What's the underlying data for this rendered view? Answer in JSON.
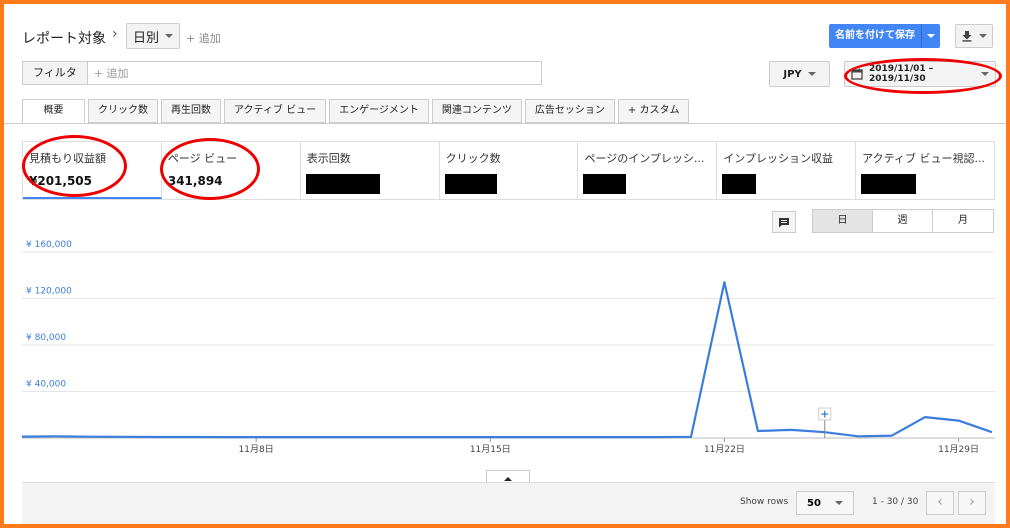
{
  "breadcrumb": {
    "report_target": "レポート対象",
    "separator": "›",
    "grouping": "日別",
    "add_label": "+ 追加"
  },
  "toolbar": {
    "save_label": "名前を付けて保存",
    "currency": "JPY",
    "date_range": "2019/11/01 – 2019/11/30"
  },
  "filter": {
    "label": "フィルタ",
    "placeholder": "+ 追加"
  },
  "tabs": [
    {
      "label": "概要"
    },
    {
      "label": "クリック数"
    },
    {
      "label": "再生回数"
    },
    {
      "label": "アクティブ ビュー"
    },
    {
      "label": "エンゲージメント"
    },
    {
      "label": "関連コンテンツ"
    },
    {
      "label": "広告セッション"
    },
    {
      "label": "+ カスタム"
    }
  ],
  "metrics": [
    {
      "title": "見積もり収益額",
      "value": "¥201,505",
      "redacted_chars": 0
    },
    {
      "title": "ページ ビュー",
      "value": "341,894",
      "redacted_chars": 0
    },
    {
      "title": "表示回数",
      "value": "",
      "redacted_chars": 7
    },
    {
      "title": "クリック数",
      "value": "",
      "redacted_chars": 5
    },
    {
      "title": "ページのインプレッシ...",
      "value": "",
      "redacted_chars": 4
    },
    {
      "title": "インプレッション収益",
      "value": "",
      "redacted_chars": 3
    },
    {
      "title": "アクティブ ビュー視認...",
      "value": "",
      "redacted_chars": 5
    }
  ],
  "granularity": {
    "day": "日",
    "week": "週",
    "month": "月",
    "selected": "day"
  },
  "chart_data": {
    "type": "line",
    "ylim": [
      0,
      160000
    ],
    "yticks": [
      40000,
      80000,
      120000,
      160000
    ],
    "ytick_labels": [
      "¥ 40,000",
      "¥ 80,000",
      "¥ 120,000",
      "¥ 160,000"
    ],
    "x": [
      1,
      2,
      3,
      4,
      5,
      6,
      7,
      8,
      9,
      10,
      11,
      12,
      13,
      14,
      15,
      16,
      17,
      18,
      19,
      20,
      21,
      22,
      23,
      24,
      25,
      26,
      27,
      28,
      29,
      30
    ],
    "xtick_days": [
      8,
      15,
      22,
      29
    ],
    "xtick_labels": [
      "11月8日",
      "11月15日",
      "11月22日",
      "11月29日"
    ],
    "series": [
      {
        "values": [
          1200,
          1500,
          1100,
          1000,
          900,
          900,
          800,
          800,
          800,
          800,
          800,
          800,
          800,
          800,
          800,
          800,
          800,
          800,
          800,
          800,
          1000,
          134000,
          6000,
          7000,
          5000,
          1500,
          2000,
          18000,
          15000,
          5000
        ]
      }
    ],
    "color": "#3b7ddd"
  },
  "pagination": {
    "show_rows_label": "Show rows",
    "rows": "50",
    "range": "1 - 30 / 30"
  },
  "icons": {
    "calendar": "calendar-icon",
    "download": "download-icon",
    "comment": "comment-icon",
    "prev": "chevron-left-icon",
    "next": "chevron-right-icon",
    "collapse": "collapse-up-icon"
  }
}
